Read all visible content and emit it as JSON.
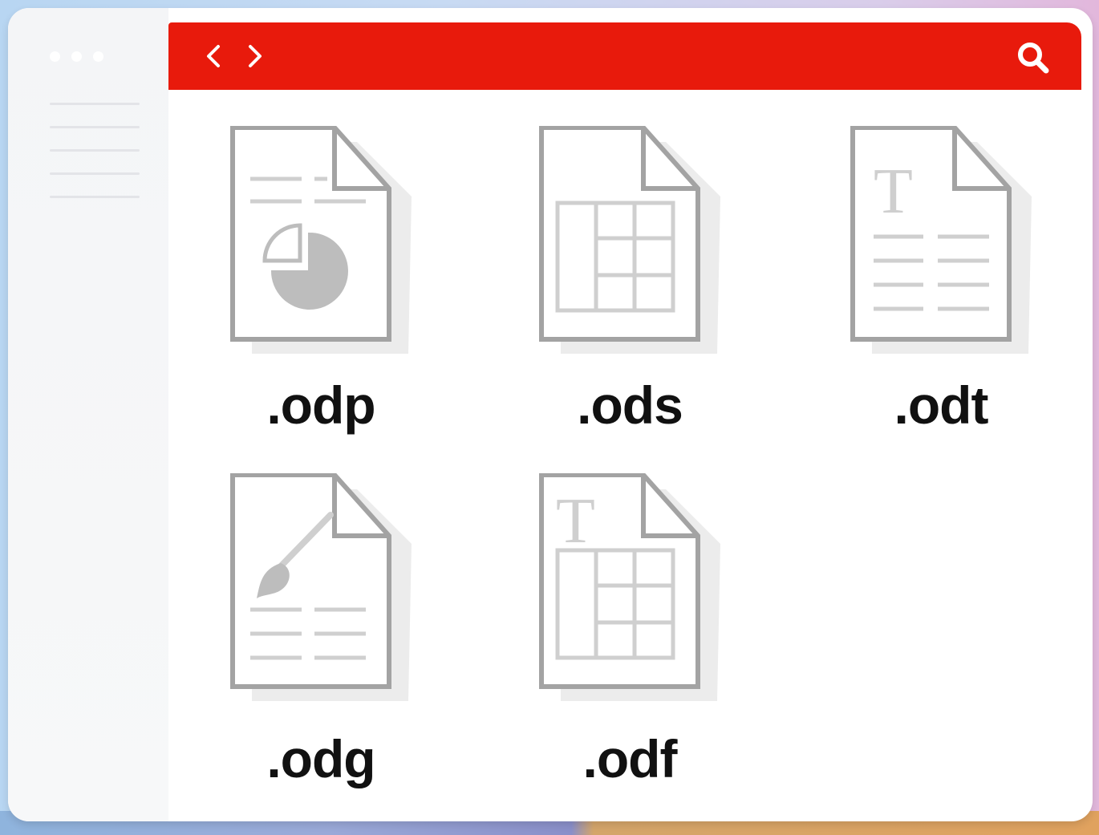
{
  "toolbar": {
    "accent_color": "#e81a0c",
    "back_icon": "chevron-left-icon",
    "forward_icon": "chevron-right-icon",
    "search_icon": "search-icon"
  },
  "files": [
    {
      "label": ".odp",
      "icon": "presentation-file-icon"
    },
    {
      "label": ".ods",
      "icon": "spreadsheet-file-icon"
    },
    {
      "label": ".odt",
      "icon": "text-document-file-icon"
    },
    {
      "label": ".odg",
      "icon": "drawing-file-icon"
    },
    {
      "label": ".odf",
      "icon": "formula-file-icon"
    }
  ]
}
